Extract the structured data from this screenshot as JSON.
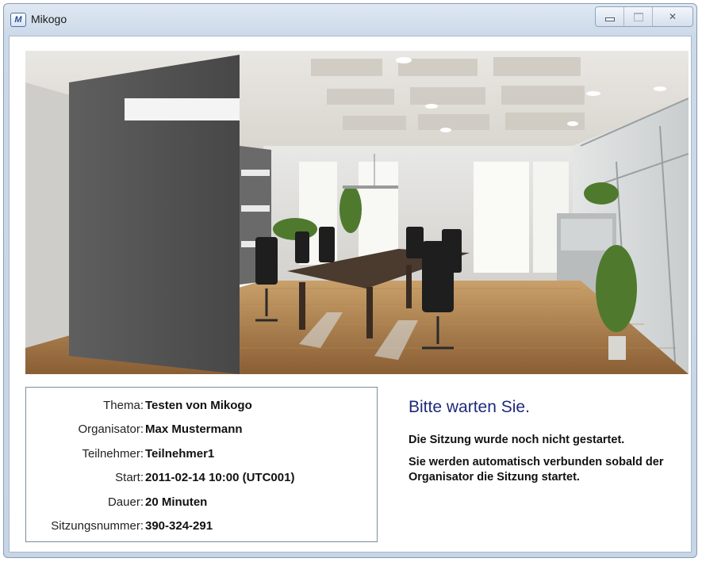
{
  "window": {
    "title": "Mikogo",
    "icon": "mikogo-logo-icon",
    "controls": [
      "minimize-icon",
      "maximize-icon",
      "close-icon"
    ]
  },
  "session_info": {
    "rows": [
      {
        "label": "Thema:",
        "value": "Testen von Mikogo"
      },
      {
        "label": "Organisator:",
        "value": "Max Mustermann"
      },
      {
        "label": "Teilnehmer:",
        "value": "Teilnehmer1"
      },
      {
        "label": "Start:",
        "value": "2011-02-14 10:00 (UTC001)"
      },
      {
        "label": "Dauer:",
        "value": "20 Minuten"
      },
      {
        "label": "Sitzungsnummer:",
        "value": "390-324-291"
      }
    ]
  },
  "status": {
    "title": "Bitte warten Sie.",
    "message_1": "Die Sitzung wurde noch nicht gestartet.",
    "message_2": "Sie werden automatisch verbunden sobald der Organisator die Sitzung startet."
  },
  "colors": {
    "status_title": "#1f2a7a",
    "window_frame": "#c7d5e6"
  }
}
